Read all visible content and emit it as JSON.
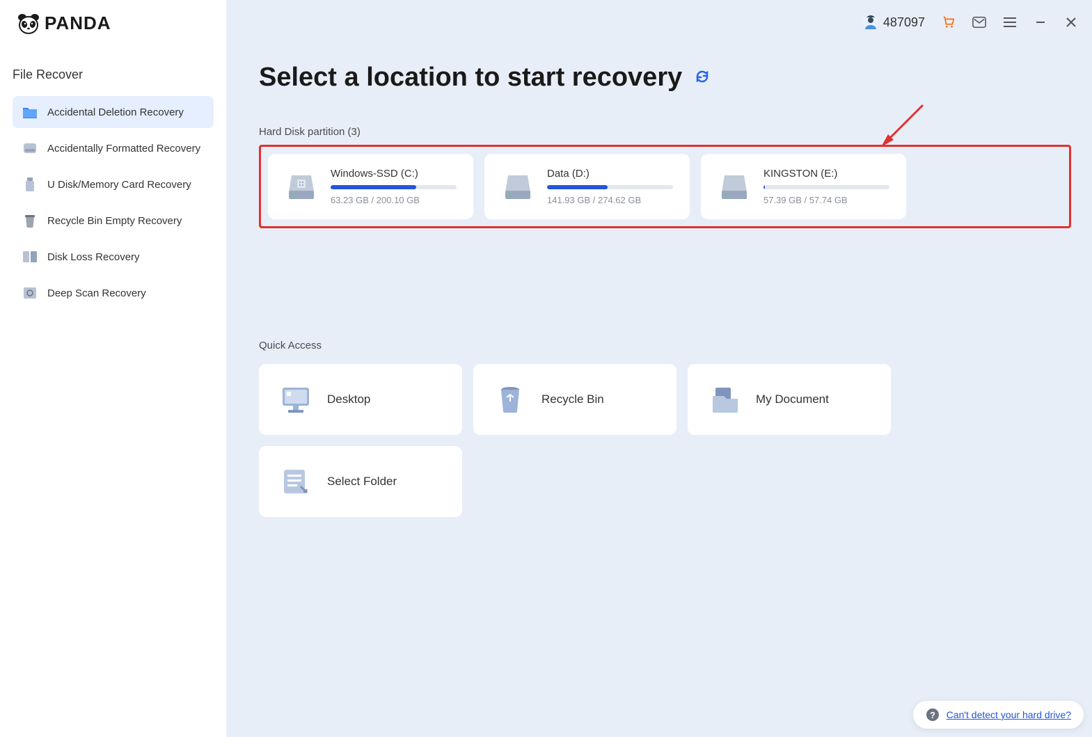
{
  "app": {
    "name": "PANDA"
  },
  "header": {
    "user_id": "487097"
  },
  "sidebar": {
    "title": "File Recover",
    "items": [
      {
        "label": "Accidental Deletion Recovery"
      },
      {
        "label": "Accidentally Formatted Recovery"
      },
      {
        "label": "U Disk/Memory Card Recovery"
      },
      {
        "label": "Recycle Bin Empty Recovery"
      },
      {
        "label": "Disk Loss Recovery"
      },
      {
        "label": "Deep Scan Recovery"
      }
    ]
  },
  "main": {
    "title": "Select a location to start recovery",
    "partition_header": "Hard Disk partition   (3)",
    "partitions": [
      {
        "name": "Windows-SSD   (C:)",
        "size": "63.23 GB / 200.10 GB",
        "fill_pct": 68
      },
      {
        "name": "Data   (D:)",
        "size": "141.93 GB / 274.62 GB",
        "fill_pct": 48
      },
      {
        "name": "KINGSTON   (E:)",
        "size": "57.39 GB / 57.74 GB",
        "fill_pct": 1
      }
    ],
    "quick_title": "Quick Access",
    "quick": [
      {
        "label": "Desktop"
      },
      {
        "label": "Recycle Bin"
      },
      {
        "label": "My Document"
      },
      {
        "label": "Select Folder"
      }
    ]
  },
  "help": {
    "link_text": "Can't detect your hard drive?"
  }
}
